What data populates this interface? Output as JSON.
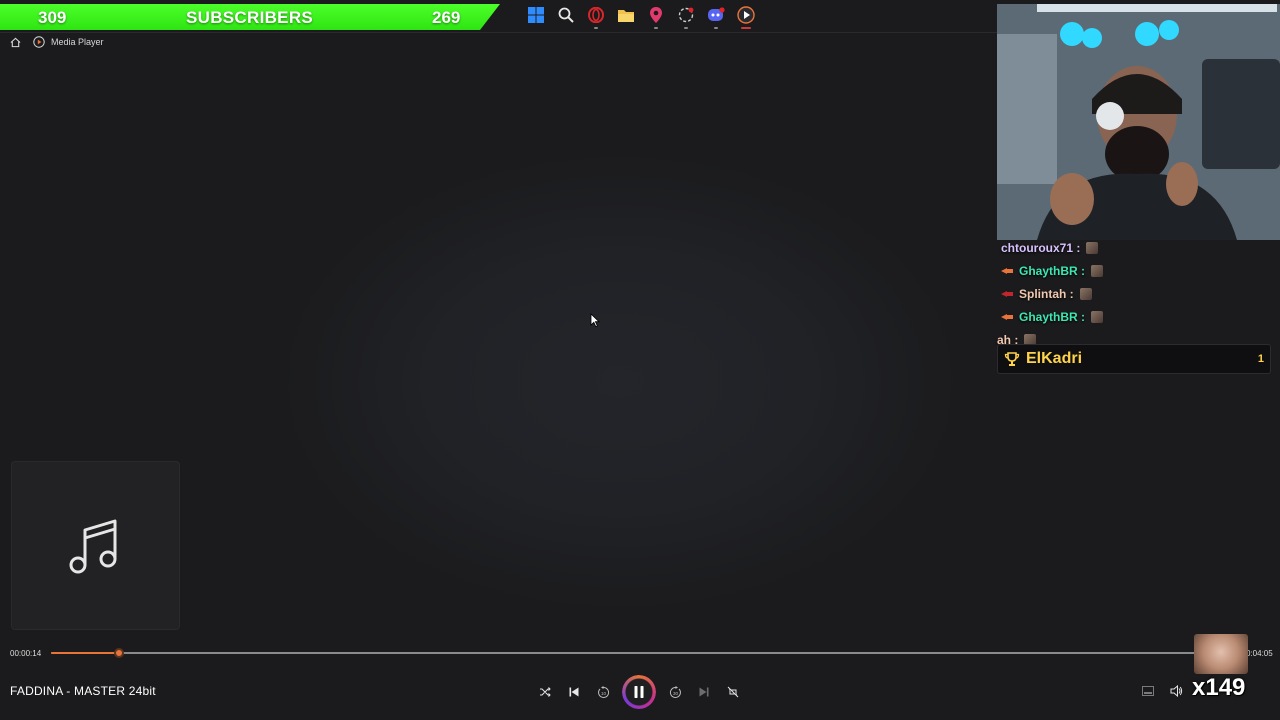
{
  "overlay": {
    "subscriber_banner": {
      "left_count": "309",
      "label": "SUBSCRIBERS",
      "right_count": "269",
      "color": "#2ee412"
    }
  },
  "taskbar": {
    "icons": [
      "windows-start-icon",
      "search-icon",
      "opera-browser-icon",
      "file-explorer-icon",
      "maps-pin-icon",
      "browser-icon",
      "discord-icon",
      "media-player-icon"
    ]
  },
  "breadcrumb": {
    "home_icon": "home-icon",
    "app_icon": "media-player-icon",
    "app_label": "Media Player"
  },
  "chat": {
    "messages": [
      {
        "user": "chtouroux71 :",
        "color": "#d9c3ff"
      },
      {
        "user": "GhaythBR :",
        "color": "#3ee6b2"
      },
      {
        "user": "Splintah :",
        "color": "#f0c7b0"
      },
      {
        "user": "GhaythBR :",
        "color": "#3ee6b2"
      },
      {
        "user": "ah :",
        "color": "#f0c7b0"
      }
    ],
    "top_donor": {
      "name": "ElKadri",
      "count": "1",
      "color": "#ffd34a"
    }
  },
  "player": {
    "current_time": "00:00:14",
    "total_time": "0:04:05",
    "progress_fraction": 0.057,
    "accent": "#e8743a",
    "now_playing": "FADDINA - MASTER 24bit",
    "combo": "x149",
    "controls": [
      "shuffle",
      "previous",
      "skip-back-10",
      "pause",
      "skip-forward-30",
      "next",
      "repeat-off"
    ],
    "right_controls": [
      "miniplayer",
      "volume",
      "more"
    ]
  }
}
